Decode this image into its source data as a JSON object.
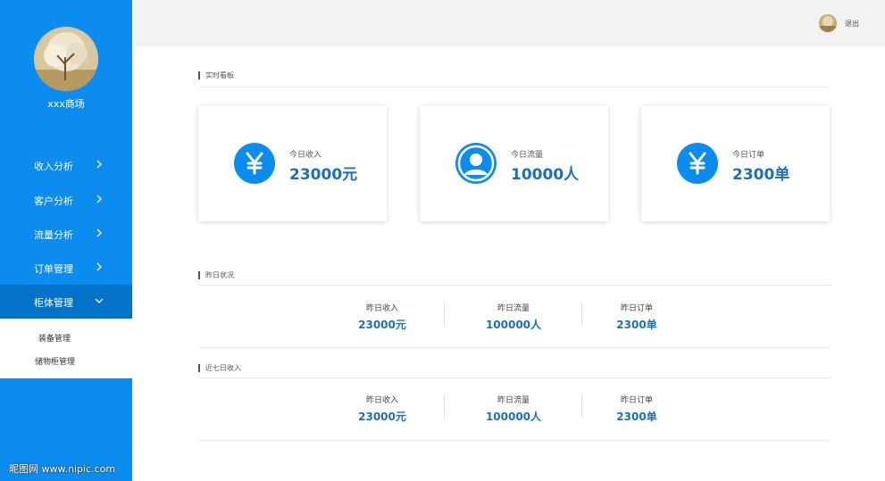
{
  "sidebar": {
    "store_name": "xxx商场",
    "items": [
      {
        "label": "收入分析",
        "icon": "chevron-right-icon"
      },
      {
        "label": "客户分析",
        "icon": "chevron-right-icon"
      },
      {
        "label": "流量分析",
        "icon": "chevron-right-icon"
      },
      {
        "label": "订单管理",
        "icon": "chevron-right-icon"
      },
      {
        "label": "柜体管理",
        "icon": "chevron-down-icon",
        "active": true
      }
    ],
    "submenu": [
      "装备管理",
      "储物柜管理"
    ]
  },
  "topbar": {
    "logout_label": "退出"
  },
  "realtime": {
    "title": "实时看板",
    "cards": [
      {
        "caption": "今日收入",
        "value": "23000元",
        "icon": "yen-icon"
      },
      {
        "caption": "今日流量",
        "value": "10000人",
        "icon": "user-icon"
      },
      {
        "caption": "今日订单",
        "value": "2300单",
        "icon": "yen-icon"
      }
    ]
  },
  "yesterday": {
    "title": "昨日状况",
    "stats": [
      {
        "caption": "昨日收入",
        "value": "23000元"
      },
      {
        "caption": "昨日流量",
        "value": "100000人"
      },
      {
        "caption": "昨日订单",
        "value": "2300单"
      }
    ]
  },
  "seven_days": {
    "title": "近七日收入",
    "stats": [
      {
        "caption": "昨日收入",
        "value": "23000元"
      },
      {
        "caption": "昨日流量",
        "value": "100000人"
      },
      {
        "caption": "昨日订单",
        "value": "2300单"
      }
    ]
  },
  "watermark": "昵图网 www.nipic.com",
  "colors": {
    "primary": "#0d8cf0",
    "active": "#0572c9",
    "value_text": "#1d6fb8"
  }
}
